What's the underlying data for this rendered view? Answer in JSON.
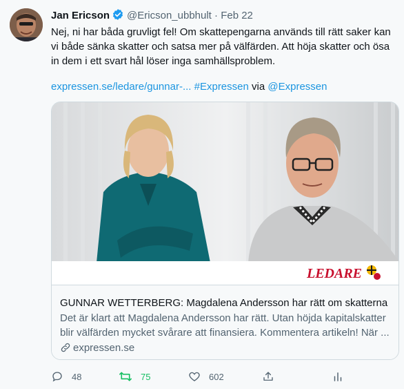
{
  "tweet": {
    "author_name": "Jan Ericson",
    "handle": "@Ericson_ubbhult",
    "separator": "·",
    "date": "Feb 22",
    "text": "Nej, ni har båda gruvligt fel! Om skattepengarna används till rätt saker kan vi både sänka skatter och satsa mer på välfärden. Att höja skatter och ösa in dem i ett svart hål löser inga samhällsproblem.",
    "link_url": "expressen.se/ledare/gunnar-...",
    "hashtag": "#Expressen",
    "via_label": "via",
    "mention": "@Expressen"
  },
  "card": {
    "badge": "LEDARE",
    "title": "GUNNAR WETTERBERG: Magdalena Andersson har rätt om skatterna",
    "description": "Det är klart att Magdalena Andersson har rätt. Utan höjda kapitalskatter blir välfärden mycket svårare att finansiera. Kommentera artikeln! När ...",
    "domain": "expressen.se"
  },
  "actions": {
    "reply_count": "48",
    "retweet_count": "75",
    "like_count": "602"
  },
  "colors": {
    "link": "#1b95e0",
    "verified": "#1d9bf0",
    "retweet_active": "#17bf63",
    "badge_red": "#c8102e"
  },
  "icons": [
    "verified-badge-icon",
    "link-icon",
    "reply-icon",
    "retweet-icon",
    "like-icon",
    "share-icon",
    "analytics-icon"
  ]
}
